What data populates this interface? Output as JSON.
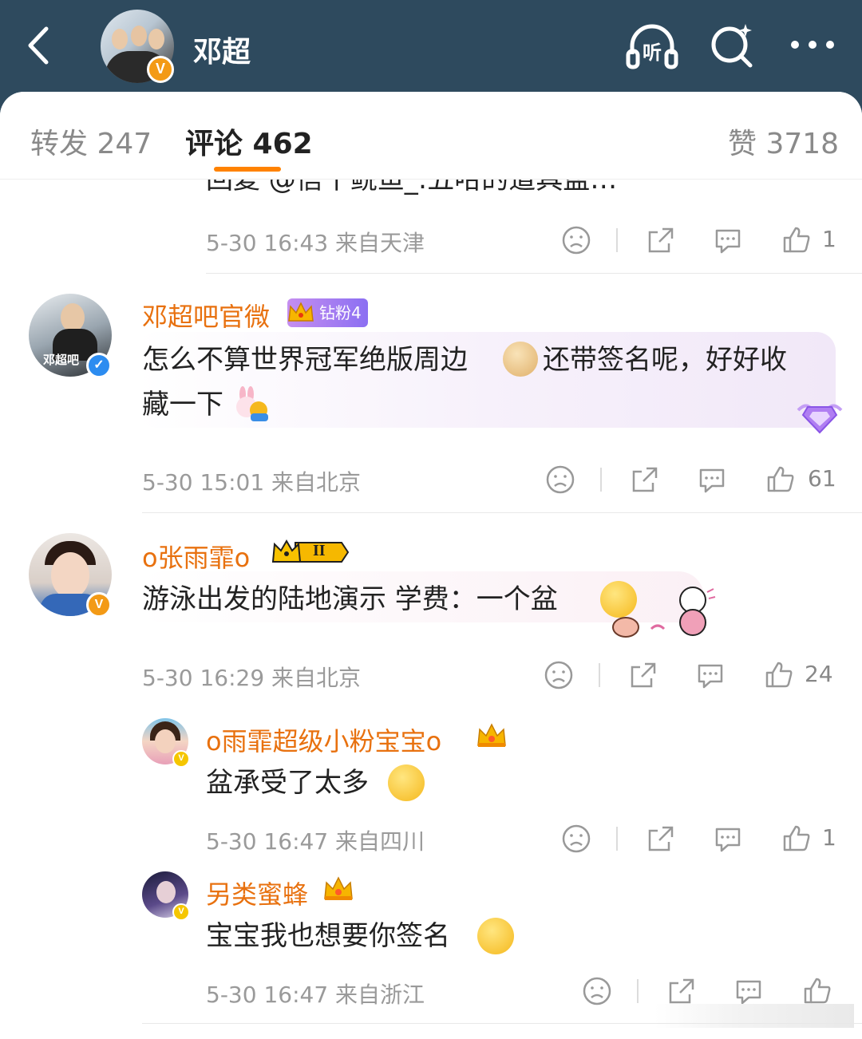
{
  "header": {
    "title": "邓超",
    "verified_letter": "V",
    "listen_label": "听",
    "icons": [
      "back-chevron-icon",
      "listen-headphones-icon",
      "search-sparkle-icon",
      "more-dots-icon"
    ]
  },
  "tabs": {
    "repost": "转发 247",
    "comments": "评论 462",
    "likes": "赞 3718"
  },
  "colors": {
    "header_bg": "#2e4a5e",
    "accent": "#ff8200",
    "username": "#e8710f",
    "meta": "#9a9a9a"
  },
  "top_partial": {
    "reply_text": "回复 @信丫鲵鱼_:五哈的道具盆…",
    "meta": "5-30 16:43 来自天津",
    "likes": "1"
  },
  "comments": [
    {
      "username": "邓超吧官微",
      "fan_badge": "钻粉4",
      "text_line1": "怎么不算世界冠军绝版周边",
      "text_line1b": "还带签名呢，好好收",
      "text_line2": "藏一下",
      "meta": "5-30 15:01 来自北京",
      "likes": "61",
      "avatar_text": "邓超吧"
    },
    {
      "username": "o张雨霏o",
      "level_badge": "II",
      "text": "游泳出发的陆地演示 学费：一个盆",
      "meta": "5-30 16:29 来自北京",
      "likes": "24"
    }
  ],
  "replies": [
    {
      "username": "o雨霏超级小粉宝宝o",
      "text": "盆承受了太多",
      "meta": "5-30 16:47 来自四川",
      "likes": "1"
    },
    {
      "username": "另类蜜蜂",
      "text": "宝宝我也想要你签名",
      "meta": "5-30 16:47 来自浙江",
      "likes": ""
    }
  ]
}
